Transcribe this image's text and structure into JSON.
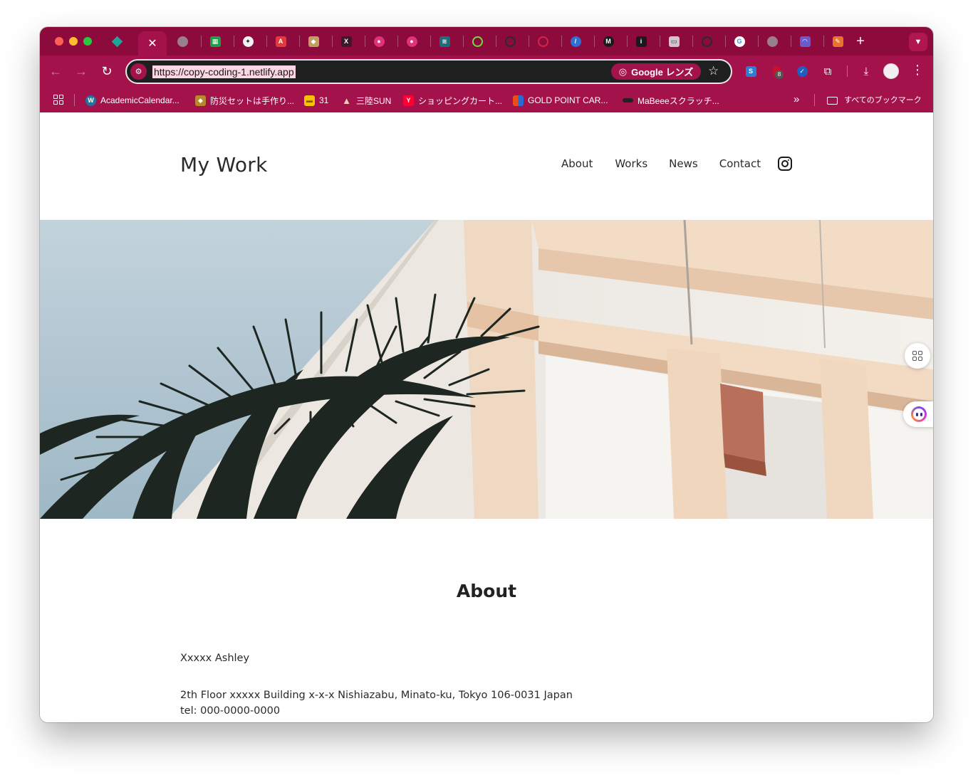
{
  "browser": {
    "url": "https://copy-coding-1.netlify.app",
    "lens_label": "Google レンズ",
    "extension_badge": "8",
    "bookmarks": [
      {
        "label": "AcademicCalendar...",
        "icon": "wordpress-icon",
        "color": "#21759b"
      },
      {
        "label": "防災セットは手作り...",
        "icon": "dog-icon",
        "color": "#b58a2f"
      },
      {
        "label": "31",
        "icon": "calendar-icon",
        "color": "#f5c400"
      },
      {
        "label": "三陸SUN",
        "icon": "tent-icon",
        "color": "#e9d7a5"
      },
      {
        "label": "ショッピングカート...",
        "icon": "y-icon",
        "color": "#ff0033"
      },
      {
        "label": "GOLD POINT CAR...",
        "icon": "grid-logo-icon",
        "color": "#e94e1b"
      },
      {
        "label": "MaBeeeスクラッチ...",
        "icon": "battery-icon",
        "color": "#222222"
      }
    ],
    "all_bookmarks_label": "すべてのブックマーク"
  },
  "site": {
    "logo": "My Work",
    "nav": [
      "About",
      "Works",
      "News",
      "Contact"
    ],
    "about": {
      "title": "About",
      "name": "Xxxxx Ashley",
      "address": "2th Floor xxxxx Building x-x-x Nishiazabu, Minato-ku, Tokyo 106-0031 Japan",
      "tel": "tel: 000-0000-0000"
    }
  },
  "colors": {
    "theme_dark": "#8c0b3c",
    "theme": "#a3124b",
    "page_bg": "#ffffff",
    "text": "#2a2a2a"
  }
}
